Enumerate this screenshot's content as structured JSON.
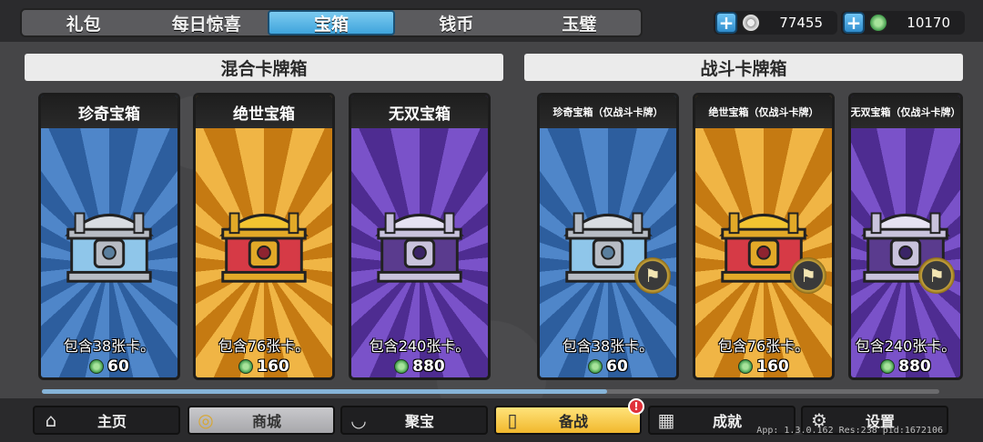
{
  "tabs": [
    {
      "label": "礼包",
      "active": false
    },
    {
      "label": "每日惊喜",
      "active": false
    },
    {
      "label": "宝箱",
      "active": true
    },
    {
      "label": "钱币",
      "active": false
    },
    {
      "label": "玉璧",
      "active": false
    }
  ],
  "currencies": {
    "coins": {
      "value": "77455",
      "icon": "coin-icon"
    },
    "jade": {
      "value": "10170",
      "icon": "jade-icon"
    }
  },
  "sections": {
    "mixed": "混合卡牌箱",
    "battle": "战斗卡牌箱"
  },
  "cards": [
    {
      "title": "珍奇宝箱",
      "desc": "包含38张卡。",
      "price": "60",
      "theme": "blue",
      "battle": false
    },
    {
      "title": "绝世宝箱",
      "desc": "包含76张卡。",
      "price": "160",
      "theme": "gold",
      "battle": false
    },
    {
      "title": "无双宝箱",
      "desc": "包含240张卡。",
      "price": "880",
      "theme": "purple",
      "battle": false
    },
    {
      "title": "珍奇宝箱（仅战斗卡牌）",
      "desc": "包含38张卡。",
      "price": "60",
      "theme": "blue",
      "battle": true
    },
    {
      "title": "绝世宝箱（仅战斗卡牌）",
      "desc": "包含76张卡。",
      "price": "160",
      "theme": "gold",
      "battle": true
    },
    {
      "title": "无双宝箱（仅战斗卡牌）",
      "desc": "包含240张卡。",
      "price": "880",
      "theme": "purple",
      "battle": true
    }
  ],
  "scroll_progress": 0.63,
  "nav": [
    {
      "label": "主页",
      "icon": "home-icon"
    },
    {
      "label": "商城",
      "icon": "coins-icon"
    },
    {
      "label": "聚宝",
      "icon": "bowl-icon"
    },
    {
      "label": "备战",
      "icon": "cards-icon"
    },
    {
      "label": "成就",
      "icon": "grid-icon"
    },
    {
      "label": "设置",
      "icon": "gear-icon"
    }
  ],
  "alert_badge": "!",
  "app_info": "App: 1.3.0.162 Res:238 pid:1672106",
  "colors": {
    "blue": "#3b6fb0",
    "gold": "#e59a23",
    "purple": "#6a3fb8",
    "active_tab": "#4fb0e3"
  }
}
